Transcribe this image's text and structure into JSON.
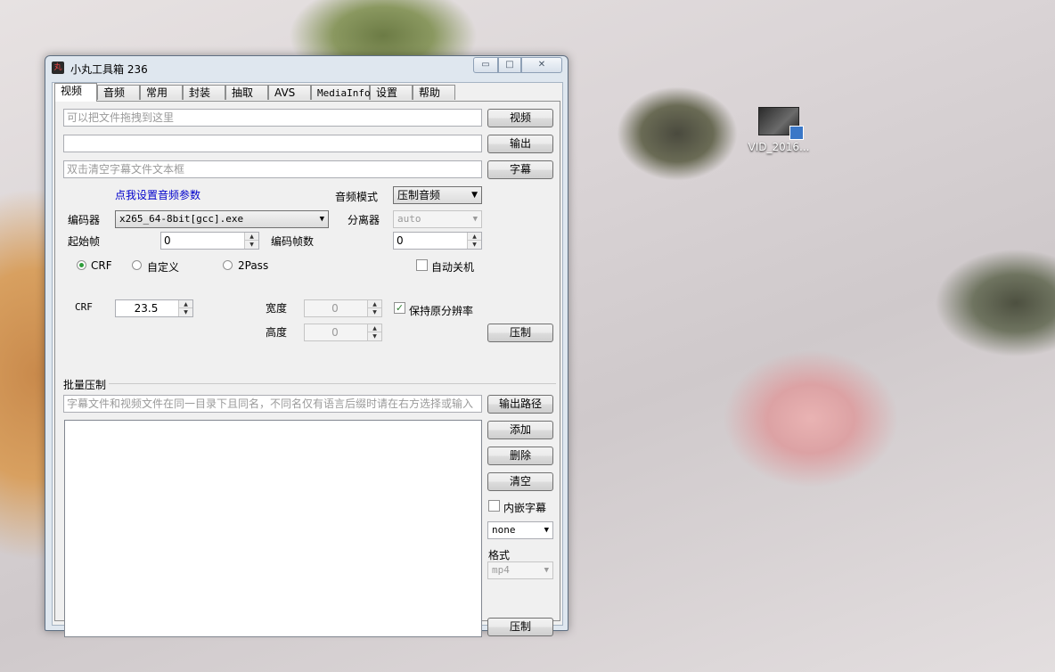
{
  "desktop": {
    "icon_label": "VID_2016..."
  },
  "window": {
    "title": "小丸工具箱 236",
    "controls": {
      "minimize": "▭",
      "maximize": "□",
      "close": "✕"
    }
  },
  "tabs": [
    "视频",
    "音频",
    "常用",
    "封装",
    "抽取",
    "AVS",
    "MediaInfo",
    "设置",
    "帮助"
  ],
  "video_tab": {
    "video_input_placeholder": "可以把文件拖拽到这里",
    "video_button": "视频",
    "output_value": "",
    "output_button": "输出",
    "subtitle_placeholder": "双击清空字幕文件文本框",
    "subtitle_button": "字幕",
    "audio_params_link": "点我设置音频参数",
    "audio_mode_label": "音频模式",
    "audio_mode_value": "压制音频",
    "encoder_label": "编码器",
    "encoder_value": "x265_64-8bit[gcc].exe",
    "demuxer_label": "分离器",
    "demuxer_value": "auto",
    "start_frame_label": "起始帧",
    "start_frame_value": "0",
    "encode_frames_label": "编码帧数",
    "encode_frames_value": "0",
    "mode_crf": "CRF",
    "mode_custom": "自定义",
    "mode_2pass": "2Pass",
    "auto_shutdown": "自动关机",
    "crf_label": "CRF",
    "crf_value": "23.5",
    "width_label": "宽度",
    "width_value": "0",
    "height_label": "高度",
    "height_value": "0",
    "keep_resolution": "保持原分辨率",
    "keep_resolution_checkmark": "✓",
    "encode_button": "压制"
  },
  "batch": {
    "group_title": "批量压制",
    "hint_placeholder": "字幕文件和视频文件在同一目录下且同名，不同名仅有语言后缀时请在右方选择或输入",
    "output_path_button": "输出路径",
    "add_button": "添加",
    "delete_button": "删除",
    "clear_button": "清空",
    "embed_subtitle": "内嵌字幕",
    "subtitle_lang_value": "none",
    "format_label": "格式",
    "format_value": "mp4",
    "encode_button": "压制"
  }
}
